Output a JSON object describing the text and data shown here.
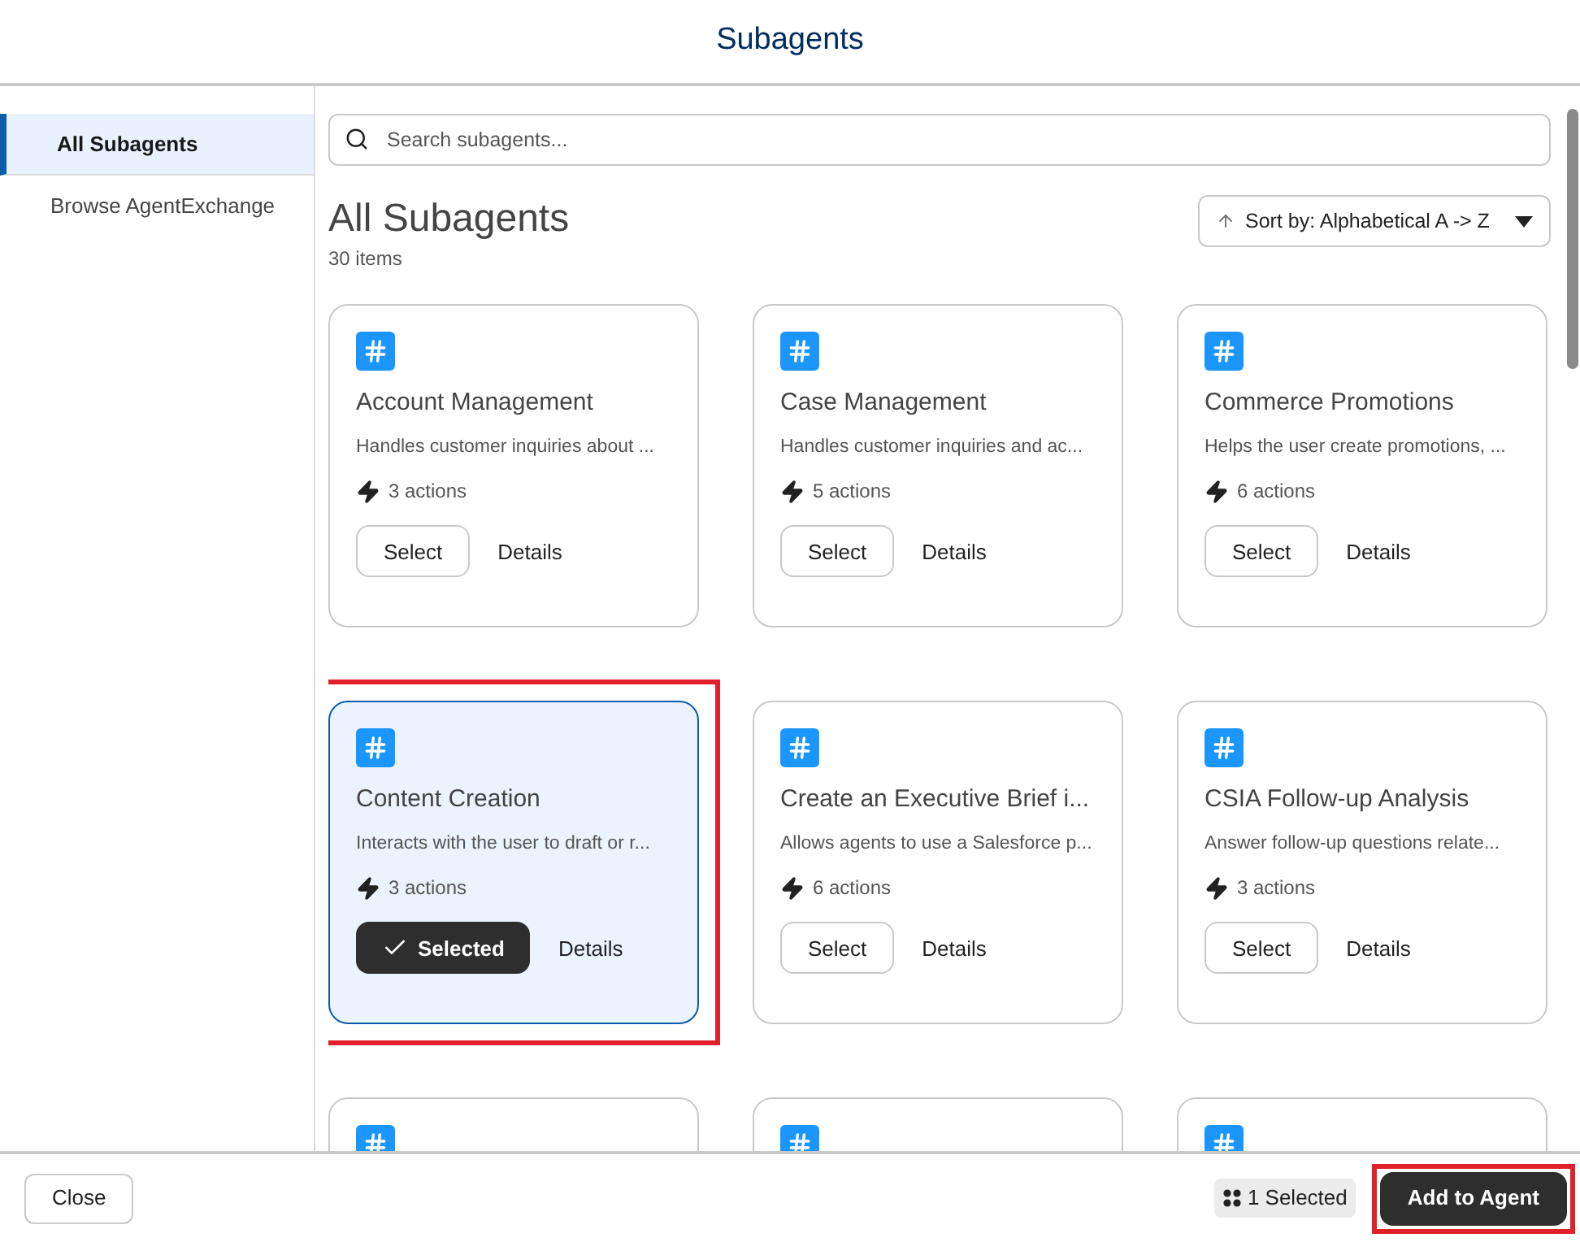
{
  "window": {
    "title": "Subagents"
  },
  "sidebar": {
    "items": [
      {
        "label": "All Subagents",
        "selected": true
      },
      {
        "label": "Browse AgentExchange",
        "selected": false
      }
    ]
  },
  "search": {
    "placeholder": "Search subagents..."
  },
  "heading": {
    "title": "All Subagents",
    "count": "30 items"
  },
  "sort": {
    "label": "Sort by: Alphabetical A -> Z"
  },
  "cards": [
    {
      "kind": "full",
      "title": "Account Management",
      "description": "Handles customer inquiries about ...",
      "actions": "3 actions",
      "button": "Select",
      "details": "Details",
      "selected": false,
      "highlighted": false
    },
    {
      "kind": "full",
      "title": "Case Management",
      "description": "Handles customer inquiries and ac...",
      "actions": "5 actions",
      "button": "Select",
      "details": "Details",
      "selected": false,
      "highlighted": false
    },
    {
      "kind": "full",
      "title": "Commerce Promotions",
      "description": "Helps the user create promotions, ...",
      "actions": "6 actions",
      "button": "Select",
      "details": "Details",
      "selected": false,
      "highlighted": false
    },
    {
      "kind": "full",
      "title": "Content Creation",
      "description": "Interacts with the user to draft or r...",
      "actions": "3 actions",
      "button": "Selected",
      "details": "Details",
      "selected": true,
      "highlighted": true
    },
    {
      "kind": "full",
      "title": "Create an Executive Brief i...",
      "description": "Allows agents to use a Salesforce p...",
      "actions": "6 actions",
      "button": "Select",
      "details": "Details",
      "selected": false,
      "highlighted": false
    },
    {
      "kind": "full",
      "title": "CSIA Follow-up Analysis",
      "description": "Answer follow-up questions relate...",
      "actions": "3 actions",
      "button": "Select",
      "details": "Details",
      "selected": false,
      "highlighted": false
    },
    {
      "kind": "cut"
    },
    {
      "kind": "cut"
    },
    {
      "kind": "cut"
    }
  ],
  "footer": {
    "close": "Close",
    "selected_count": "1 Selected",
    "add": {
      "label": "Add to Agent",
      "highlighted": true
    }
  }
}
